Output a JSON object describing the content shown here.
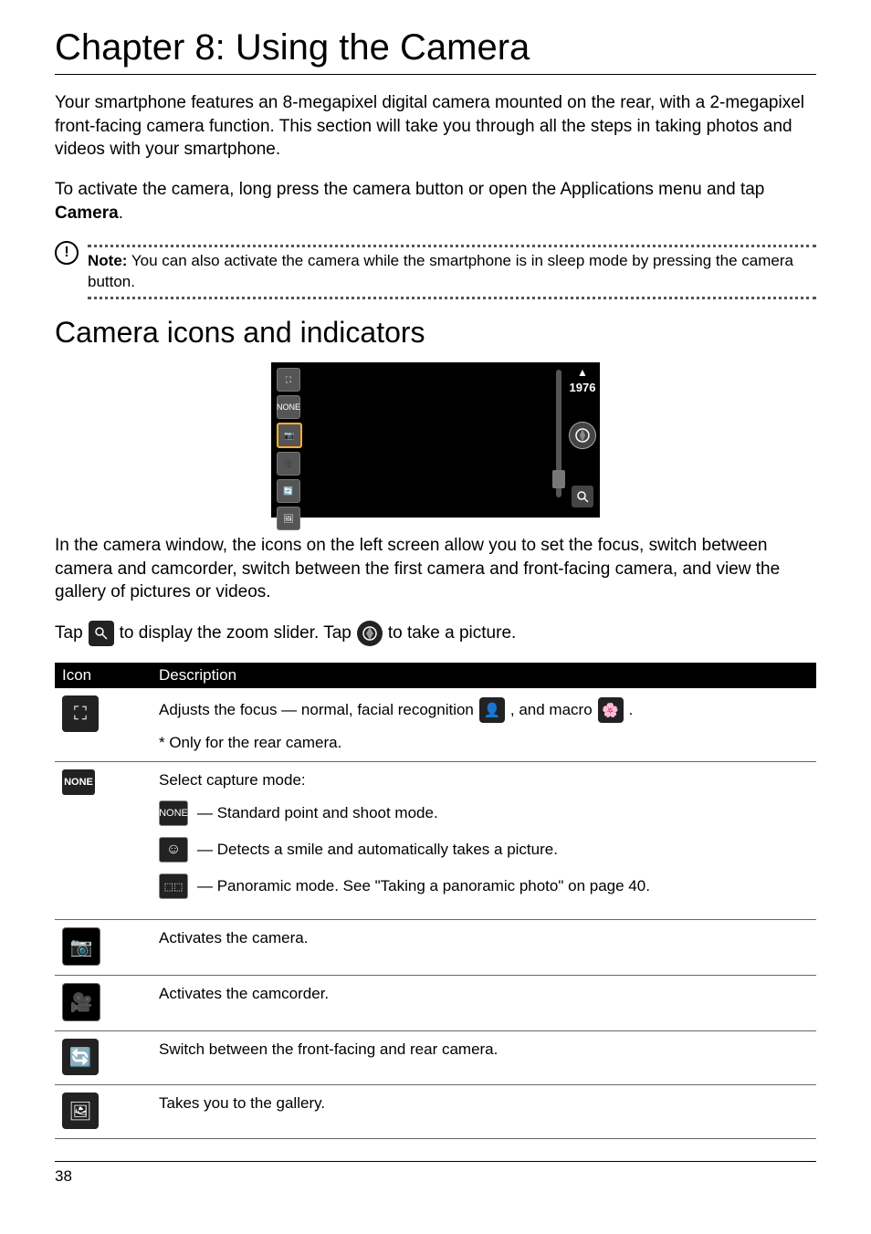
{
  "chapter_title": "Chapter 8: Using the Camera",
  "intro_paragraphs": {
    "p1": "Your smartphone features an 8-megapixel digital camera mounted on the rear, with a 2-megapixel front-facing camera function. This section will take you through all the steps in taking photos and videos with your smartphone.",
    "p2_pre": "To activate the camera, long press the camera button or open the Applications menu and tap ",
    "p2_bold": "Camera",
    "p2_post": "."
  },
  "note": {
    "label": "Note:",
    "text": " You can also activate the camera while the smartphone is in sleep mode by pressing the camera button."
  },
  "section_title": "Camera icons and indicators",
  "camera_preview": {
    "zoom_indicator_glyph": "▲",
    "photos_remaining": "1976",
    "left_icons": [
      {
        "name": "focus-mode-icon",
        "glyph": "⛶"
      },
      {
        "name": "capture-mode-none-icon",
        "glyph": "NONE"
      },
      {
        "name": "camera-mode-icon",
        "glyph": "📷"
      },
      {
        "name": "camcorder-mode-icon",
        "glyph": "🎥"
      },
      {
        "name": "switch-camera-icon",
        "glyph": "🔄"
      },
      {
        "name": "gallery-icon",
        "glyph": "🖼"
      }
    ]
  },
  "after_preview_p": "In the camera window, the icons on the left screen allow you to set the focus, switch between camera and camcorder, switch between the first camera and front-facing camera, and view the gallery of pictures or videos.",
  "tap_line": {
    "t1": "Tap ",
    "t2": " to display the zoom slider. Tap ",
    "t3": " to take a picture."
  },
  "table_headers": {
    "icon": "Icon",
    "description": "Description"
  },
  "table_rows": {
    "focus": {
      "icon_glyph": "⛶",
      "d1": "Adjusts the focus — normal, facial recognition ",
      "d2": ", and macro ",
      "d3": ".",
      "only": "* Only for the rear camera.",
      "face_glyph": "👤",
      "macro_glyph": "🌸"
    },
    "capture": {
      "icon_glyph": "NONE",
      "heading": "Select capture mode:",
      "modes": [
        {
          "name": "mode-none-icon",
          "glyph": "NONE",
          "text": " — Standard point and shoot mode."
        },
        {
          "name": "mode-smile-icon",
          "glyph": "☺",
          "text": " — Detects a smile and automatically takes a picture."
        },
        {
          "name": "mode-panorama-icon",
          "glyph": "⬚⬚",
          "text": " — Panoramic mode. See \"Taking a panoramic photo\" on page 40."
        }
      ]
    },
    "camera": {
      "icon_glyph": "📷",
      "text": "Activates the camera."
    },
    "camcorder": {
      "icon_glyph": "🎥",
      "text": "Activates the camcorder."
    },
    "switch": {
      "icon_glyph": "🔄",
      "text": "Switch between the front-facing and rear camera."
    },
    "gallery": {
      "icon_glyph": "🖼",
      "text": "Takes you to the gallery."
    }
  },
  "page_number": "38"
}
